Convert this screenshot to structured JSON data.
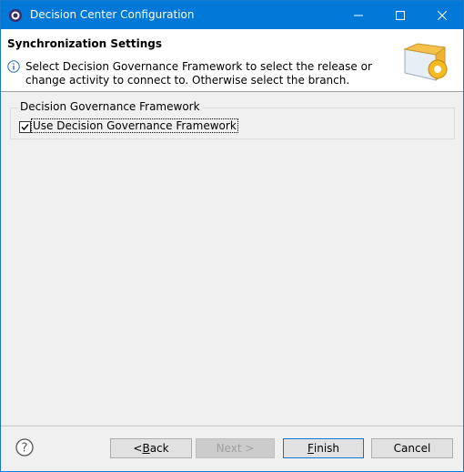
{
  "window": {
    "title": "Decision Center Configuration"
  },
  "header": {
    "title": "Synchronization Settings",
    "description": "Select Decision Governance Framework to select the release or change activity to connect to. Otherwise select the branch."
  },
  "group": {
    "legend": "Decision Governance Framework",
    "checkbox_label": "Use Decision Governance Framework",
    "checked": true
  },
  "buttons": {
    "back_mnemonic": "B",
    "back_rest": "ack",
    "back_prefix": "< ",
    "next_label": "Next >",
    "finish_mnemonic": "F",
    "finish_rest": "inish",
    "cancel_label": "Cancel"
  },
  "colors": {
    "titlebar": "#0078d7",
    "accent": "#0078d7"
  }
}
